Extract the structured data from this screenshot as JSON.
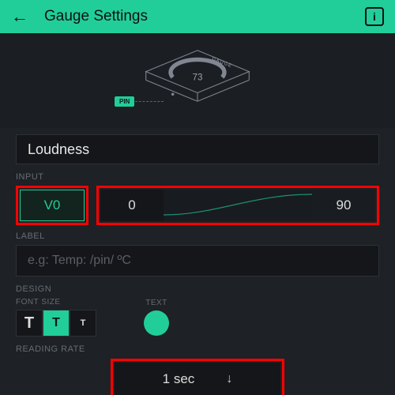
{
  "header": {
    "title": "Gauge Settings"
  },
  "illustration": {
    "widget_label": "GAUGE",
    "sample_value": "73",
    "pin_tag": "PIN"
  },
  "name": {
    "value": "Loudness"
  },
  "input": {
    "section_label": "INPUT",
    "pin": "V0",
    "range_min": "0",
    "range_max": "90"
  },
  "label": {
    "section_label": "LABEL",
    "placeholder": "e.g: Temp: /pin/ ºC"
  },
  "design": {
    "section_label": "DESIGN",
    "font_size_label": "FONT SIZE",
    "text_label": "TEXT",
    "text_color": "#21ce99",
    "font_glyph": "T"
  },
  "reading_rate": {
    "section_label": "READING RATE",
    "value": "1 sec"
  }
}
